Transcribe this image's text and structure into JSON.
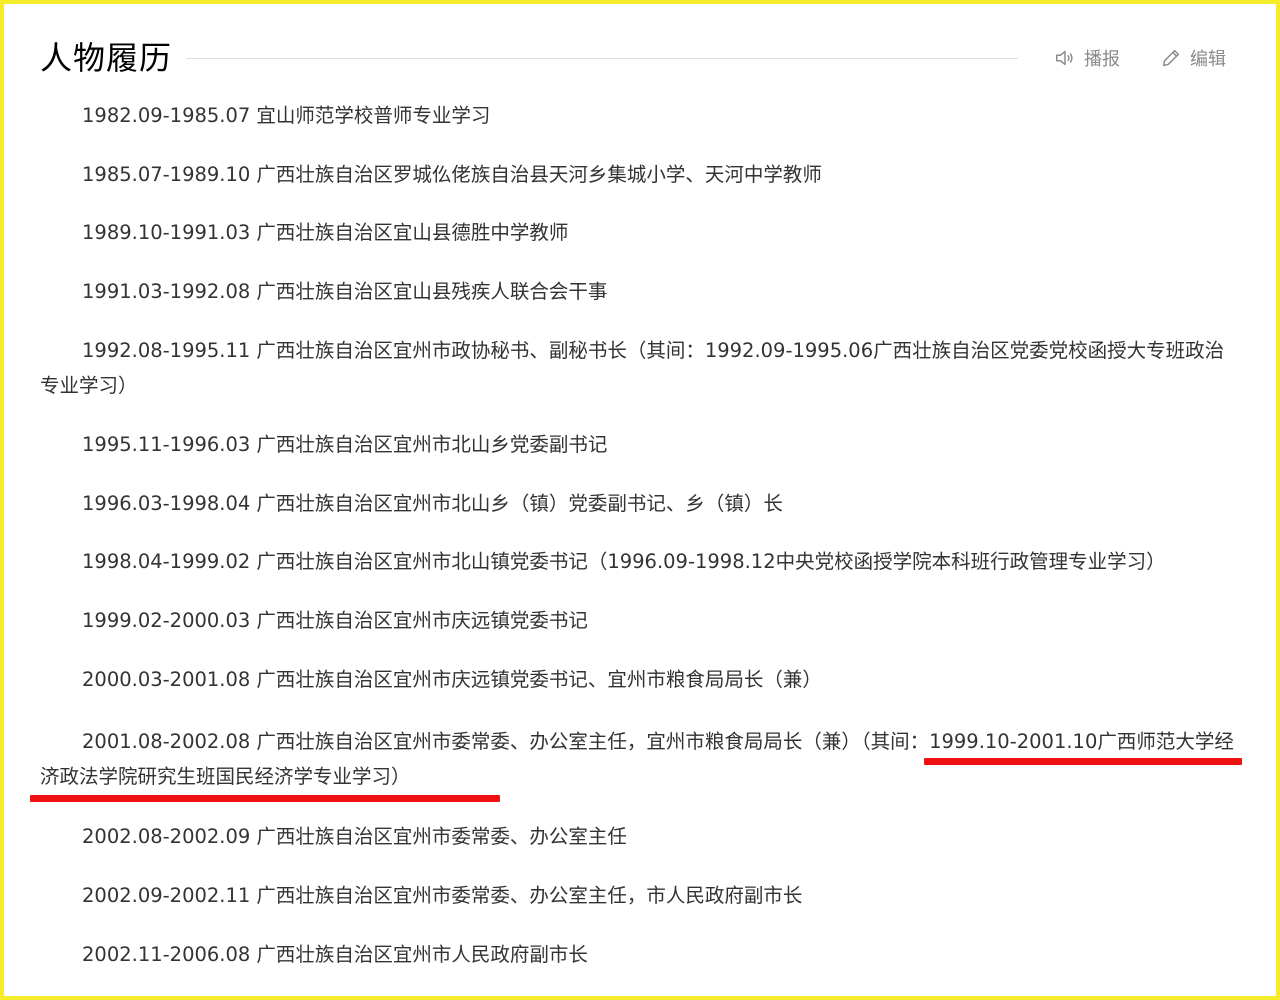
{
  "section": {
    "title": "人物履历",
    "actions": {
      "play_label": "播报",
      "edit_label": "编辑"
    }
  },
  "entries": [
    {
      "date": "1982.09-1985.07",
      "text": "宜山师范学校普师专业学习"
    },
    {
      "date": "1985.07-1989.10",
      "text": "广西壮族自治区罗城仫佬族自治县天河乡集城小学、天河中学教师"
    },
    {
      "date": "1989.10-1991.03",
      "text": "广西壮族自治区宜山县德胜中学教师"
    },
    {
      "date": "1991.03-1992.08",
      "text": "广西壮族自治区宜山县残疾人联合会干事"
    },
    {
      "date": "1992.08-1995.11",
      "text": "广西壮族自治区宜州市政协秘书、副秘书长（其间：1992.09-1995.06广西壮族自治区党委党校函授大专班政治专业学习）"
    },
    {
      "date": "1995.11-1996.03",
      "text": "广西壮族自治区宜州市北山乡党委副书记"
    },
    {
      "date": "1996.03-1998.04",
      "text": "广西壮族自治区宜州市北山乡（镇）党委副书记、乡（镇）长"
    },
    {
      "date": "1998.04-1999.02",
      "text": "广西壮族自治区宜州市北山镇党委书记（1996.09-1998.12中央党校函授学院本科班行政管理专业学习）"
    },
    {
      "date": "1999.02-2000.03",
      "text": "广西壮族自治区宜州市庆远镇党委书记"
    },
    {
      "date": "2000.03-2001.08",
      "text": "广西壮族自治区宜州市庆远镇党委书记、宜州市粮食局局长（兼）"
    },
    {
      "date": "2001.08-2002.08",
      "text": "广西壮族自治区宜州市委常委、办公室主任，宜州市粮食局局长（兼）（其间：1999.10-2001.10广西师范大学经济政法学院研究生班国民经济学专业学习）"
    },
    {
      "date": "2002.08-2002.09",
      "text": "广西壮族自治区宜州市委常委、办公室主任"
    },
    {
      "date": "2002.09-2002.11",
      "text": "广西壮族自治区宜州市委常委、办公室主任，市人民政府副市长"
    },
    {
      "date": "2002.11-2006.08",
      "text": "广西壮族自治区宜州市人民政府副市长"
    }
  ],
  "colors": {
    "border": "#f5ec2a",
    "highlight_underline": "#ee1111",
    "text": "#333333",
    "muted": "#8a8a8a"
  },
  "icons": [
    "speaker-icon",
    "pencil-icon"
  ]
}
